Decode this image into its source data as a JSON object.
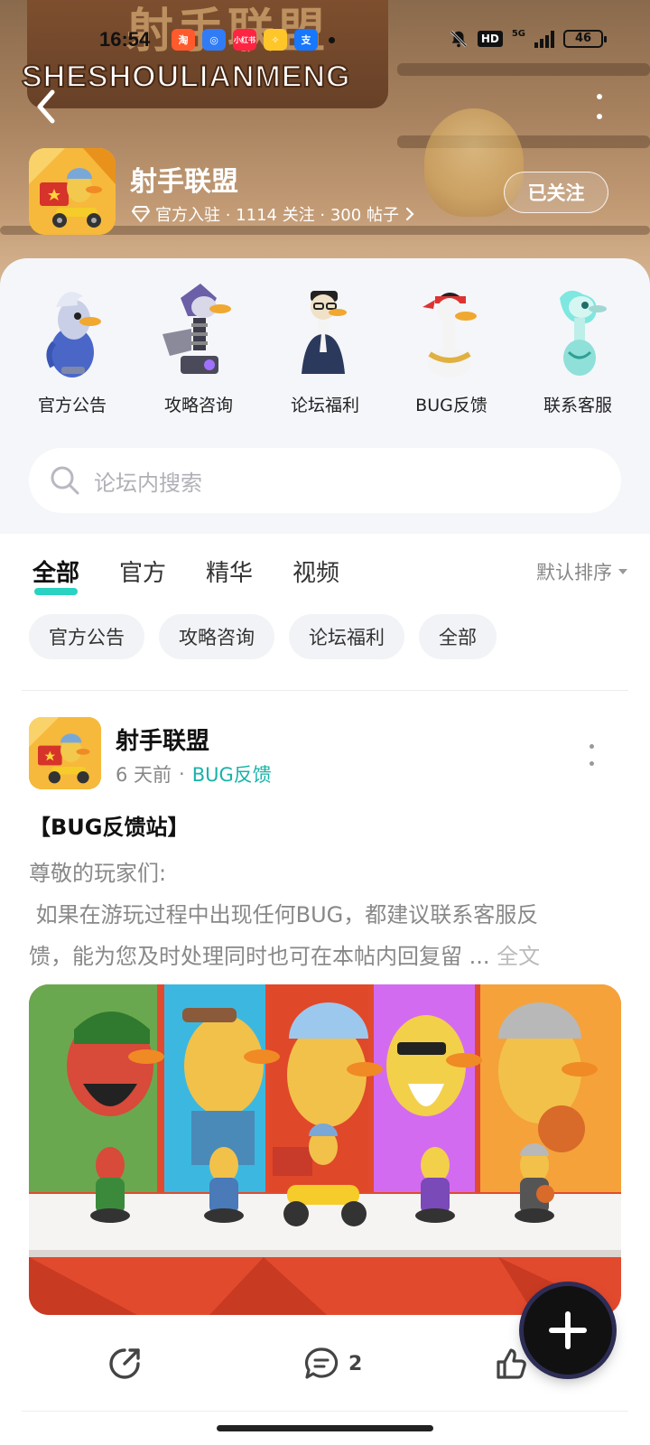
{
  "status_bar": {
    "time": "16:54",
    "app_badges": [
      {
        "label": "淘",
        "color": "#ff5a2c"
      },
      {
        "label": "◎",
        "color": "#2f7cf6"
      },
      {
        "label": "小红书",
        "color": "#ff2442"
      },
      {
        "label": "✧",
        "color": "#ffc629"
      },
      {
        "label": "支",
        "color": "#1677ff"
      }
    ],
    "hd": "HD",
    "network": "5G",
    "battery": "46"
  },
  "banner": {
    "logo_cn": "射手联盟",
    "logo_en": "SHESHOULIANMENG"
  },
  "forum": {
    "name": "射手联盟",
    "meta": "官方入驻 · 1114 关注 · 300 帖子",
    "follow_label": "已关注"
  },
  "quick_links": [
    {
      "label": "官方公告",
      "icon": "gray-bird-icon"
    },
    {
      "label": "攻略咨询",
      "icon": "mech-bird-icon"
    },
    {
      "label": "论坛福利",
      "icon": "suit-goose-icon"
    },
    {
      "label": "BUG反馈",
      "icon": "headband-goose-icon"
    },
    {
      "label": "联系客服",
      "icon": "ghost-bird-icon"
    }
  ],
  "search": {
    "placeholder": "论坛内搜索"
  },
  "tabs": [
    {
      "label": "全部",
      "active": true
    },
    {
      "label": "官方",
      "active": false
    },
    {
      "label": "精华",
      "active": false
    },
    {
      "label": "视频",
      "active": false
    }
  ],
  "sort_label": "默认排序",
  "chips": [
    "官方公告",
    "攻略咨询",
    "论坛福利",
    "全部"
  ],
  "post": {
    "author": "射手联盟",
    "time": "6 天前",
    "category": "BUG反馈",
    "title": "【BUG反馈站】",
    "line1": "尊敬的玩家们:",
    "line2": " 如果在游玩过程中出现任何BUG，都建议联系客服反",
    "line3": "馈，能为您及时处理同时也可在本帖内回复留 ...",
    "full_text_label": "全文",
    "comment_count": "2"
  },
  "colors": {
    "accent": "#2ad2c1",
    "category_text": "#17b3a8",
    "banner": "#a8825f"
  }
}
